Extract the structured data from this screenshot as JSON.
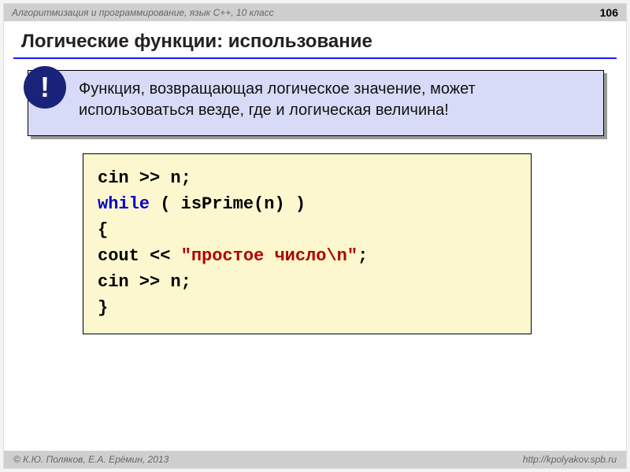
{
  "header": {
    "subject": "Алгоритмизация и программирование, язык  C++, 10 класс",
    "page": "106"
  },
  "title": "Логические функции: использование",
  "callout": {
    "badge": "!",
    "text": "Функция, возвращающая логическое значение, может использоваться везде, где и логическая величина!"
  },
  "code": {
    "l1": "cin >> n;",
    "l2_kw": "while",
    "l2_rest": " ( isPrime(n) )",
    "l3": "  {",
    "l4_a": "  cout << ",
    "l4_str": "\"простое число\\n\"",
    "l4_b": ";",
    "l5": "  cin >> n;",
    "l6": "  }"
  },
  "footer": {
    "authors": "© К.Ю. Поляков, Е.А. Ерёмин, 2013",
    "url": "http://kpolyakov.spb.ru"
  }
}
